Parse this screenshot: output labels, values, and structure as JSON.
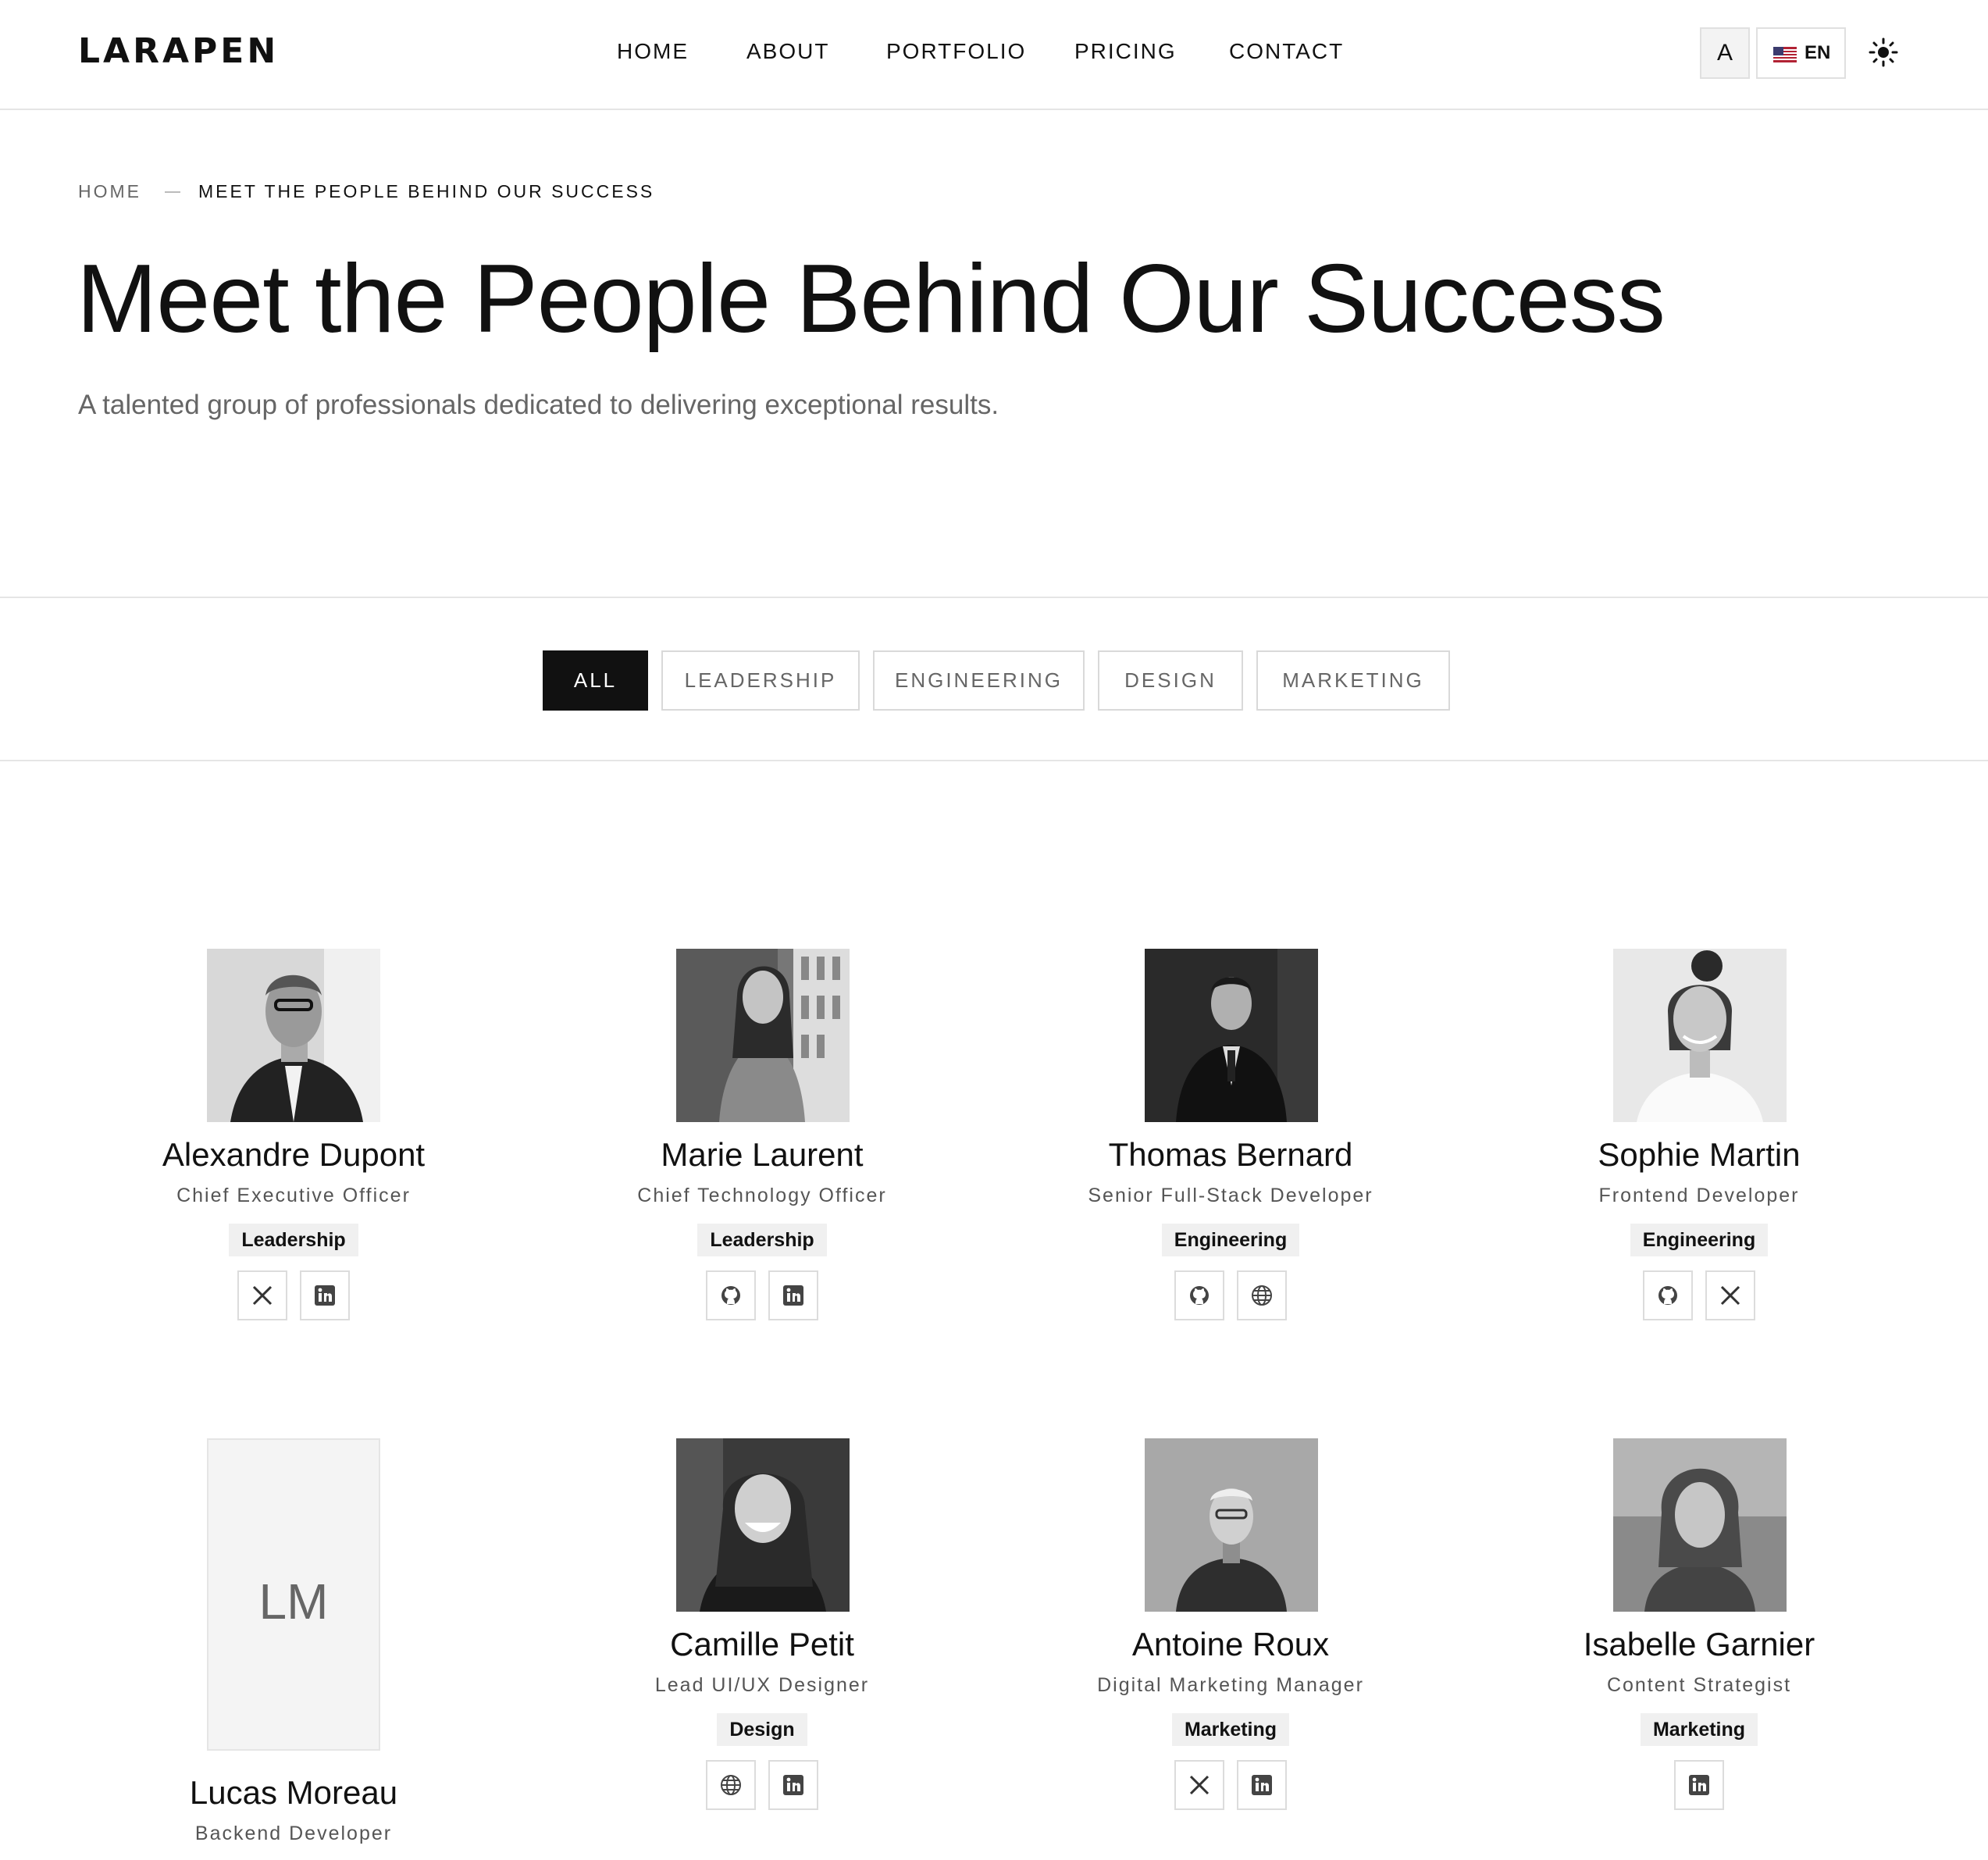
{
  "header": {
    "logo": "LARAPEN",
    "nav": [
      "HOME",
      "ABOUT",
      "PORTFOLIO",
      "PRICING",
      "CONTACT"
    ],
    "font_toggle": "A",
    "language": "EN",
    "theme_icon": "sun-icon"
  },
  "hero": {
    "breadcrumb_home": "HOME",
    "breadcrumb_current": "MEET THE PEOPLE BEHIND OUR SUCCESS",
    "title": "Meet the People Behind Our Success",
    "subtitle": "A talented group of professionals dedicated to delivering exceptional results."
  },
  "filters": {
    "items": [
      "ALL",
      "LEADERSHIP",
      "ENGINEERING",
      "DESIGN",
      "MARKETING"
    ],
    "active": "ALL"
  },
  "team": [
    {
      "name": "Alexandre Dupont",
      "role": "Chief Executive Officer",
      "department": "Leadership",
      "socials": [
        "x-icon",
        "linkedin-icon"
      ]
    },
    {
      "name": "Marie Laurent",
      "role": "Chief Technology Officer",
      "department": "Leadership",
      "socials": [
        "github-icon",
        "linkedin-icon"
      ]
    },
    {
      "name": "Thomas Bernard",
      "role": "Senior Full-Stack Developer",
      "department": "Engineering",
      "socials": [
        "github-icon",
        "globe-icon"
      ]
    },
    {
      "name": "Sophie Martin",
      "role": "Frontend Developer",
      "department": "Engineering",
      "socials": [
        "github-icon",
        "x-icon"
      ]
    },
    {
      "name": "Lucas Moreau",
      "role": "Backend Developer",
      "initials": "LM"
    },
    {
      "name": "Camille Petit",
      "role": "Lead UI/UX Designer",
      "department": "Design",
      "socials": [
        "globe-icon",
        "linkedin-icon"
      ]
    },
    {
      "name": "Antoine Roux",
      "role": "Digital Marketing Manager",
      "department": "Marketing",
      "socials": [
        "x-icon",
        "linkedin-icon"
      ]
    },
    {
      "name": "Isabelle Garnier",
      "role": "Content Strategist",
      "department": "Marketing",
      "socials": [
        "linkedin-icon"
      ]
    }
  ]
}
